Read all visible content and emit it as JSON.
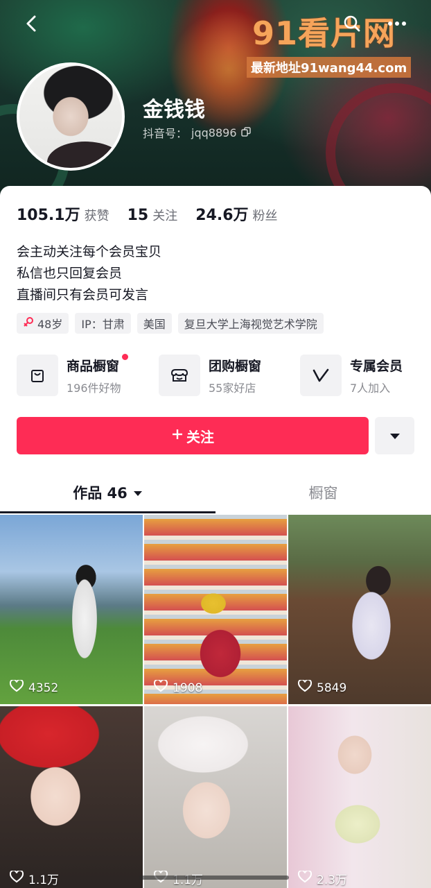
{
  "header": {
    "back_icon": "back-arrow-icon",
    "search_icon": "search-icon",
    "more_icon": "more-dots-icon",
    "watermark_title": "91看片网",
    "watermark_sub": "最新地址91wang44.com"
  },
  "profile": {
    "name": "金钱钱",
    "douyin_id_label": "抖音号：",
    "douyin_id": "jqq8896",
    "copy_icon": "copy-icon"
  },
  "stats": [
    {
      "value": "105.1万",
      "label": "获赞"
    },
    {
      "value": "15",
      "label": "关注"
    },
    {
      "value": "24.6万",
      "label": "粉丝"
    }
  ],
  "bio": [
    "会主动关注每个会员宝贝",
    "私信也只回复会员",
    "直播间只有会员可发言"
  ],
  "tags": {
    "age": "48岁",
    "ip": "IP：甘肃",
    "country": "美国",
    "school": "复旦大学上海视觉艺术学院"
  },
  "shortcuts": [
    {
      "title": "商品橱窗",
      "sub": "196件好物",
      "icon": "shopping-bag-icon",
      "has_dot": true
    },
    {
      "title": "团购橱窗",
      "sub": "55家好店",
      "icon": "storefront-icon",
      "has_dot": false
    },
    {
      "title": "专属会员",
      "sub": "7人加入",
      "icon": "v-badge-icon",
      "has_dot": false
    }
  ],
  "actions": {
    "follow_label": "关注",
    "more_icon": "triangle-down-icon"
  },
  "tabs": {
    "works_label": "作品 46",
    "showcase_label": "橱窗"
  },
  "grid": [
    {
      "likes": "4352"
    },
    {
      "likes": "1908"
    },
    {
      "likes": "5849"
    },
    {
      "likes": "1.1万"
    },
    {
      "likes": "1.1万"
    },
    {
      "likes": "2.3万"
    }
  ],
  "colors": {
    "accent": "#fe2c55",
    "text": "#161823",
    "muted": "#8a8b91",
    "chip_bg": "#f2f2f4"
  }
}
